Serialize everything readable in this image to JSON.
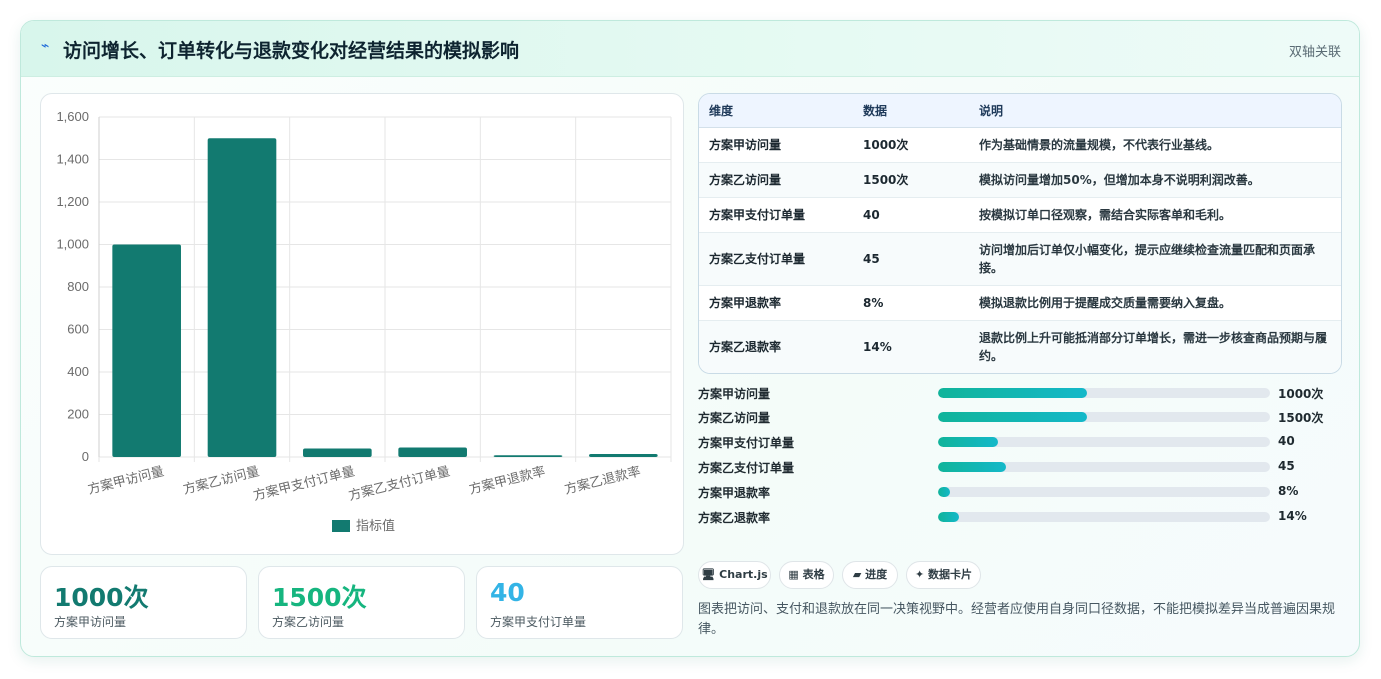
{
  "header": {
    "icon": "lightning-icon",
    "title": "访问增长、订单转化与退款变化对经营结果的模拟影响",
    "tag": "双轴关联"
  },
  "chart_data": {
    "type": "bar",
    "categories": [
      "方案甲访问量",
      "方案乙访问量",
      "方案甲支付订单量",
      "方案乙支付订单量",
      "方案甲退款率",
      "方案乙退款率"
    ],
    "series": [
      {
        "name": "指标值",
        "values": [
          1000,
          1500,
          40,
          45,
          8,
          14
        ],
        "color": "#127a70"
      }
    ],
    "ylim": [
      0,
      1600
    ],
    "yticks": [
      "0",
      "200",
      "400",
      "600",
      "800",
      "1,000",
      "1,200",
      "1,400",
      "1,600"
    ],
    "grid": true,
    "legend": "bottom"
  },
  "stats": [
    {
      "value": "1000次",
      "label": "方案甲访问量",
      "color": "#127a70"
    },
    {
      "value": "1500次",
      "label": "方案乙访问量",
      "color": "#16b57f"
    },
    {
      "value": "40",
      "label": "方案甲支付订单量",
      "color": "#33b4e6"
    }
  ],
  "table": {
    "headers": [
      "维度",
      "数据",
      "说明"
    ],
    "rows": [
      {
        "dim": "方案甲访问量",
        "data": "1000次",
        "desc": "作为基础情景的流量规模，不代表行业基线。"
      },
      {
        "dim": "方案乙访问量",
        "data": "1500次",
        "desc": "模拟访问量增加50%，但增加本身不说明利润改善。"
      },
      {
        "dim": "方案甲支付订单量",
        "data": "40",
        "desc": "按模拟订单口径观察，需结合实际客单和毛利。"
      },
      {
        "dim": "方案乙支付订单量",
        "data": "45",
        "desc": "访问增加后订单仅小幅变化，提示应继续检查流量匹配和页面承接。"
      },
      {
        "dim": "方案甲退款率",
        "data": "8%",
        "desc": "模拟退款比例用于提醒成交质量需要纳入复盘。"
      },
      {
        "dim": "方案乙退款率",
        "data": "14%",
        "desc": "退款比例上升可能抵消部分订单增长，需进一步核查商品预期与履约。"
      }
    ]
  },
  "progress": [
    {
      "label": "方案甲访问量",
      "value": "1000次",
      "fill_percent": 45
    },
    {
      "label": "方案乙访问量",
      "value": "1500次",
      "fill_percent": 45
    },
    {
      "label": "方案甲支付订单量",
      "value": "40",
      "fill_percent": 18
    },
    {
      "label": "方案乙支付订单量",
      "value": "45",
      "fill_percent": 20.5
    },
    {
      "label": "方案甲退款率",
      "value": "8%",
      "fill_percent": 3.6
    },
    {
      "label": "方案乙退款率",
      "value": "14%",
      "fill_percent": 6.3
    }
  ],
  "chips": [
    {
      "icon": "monitor-icon",
      "glyph": "🖥",
      "label": "Chart.js"
    },
    {
      "icon": "table-icon",
      "glyph": "▦",
      "label": "表格"
    },
    {
      "icon": "progress-icon",
      "glyph": "▰",
      "label": "进度"
    },
    {
      "icon": "sparkle-icon",
      "glyph": "✦",
      "label": "数据卡片"
    }
  ],
  "note": "图表把访问、支付和退款放在同一决策视野中。经营者应使用自身同口径数据，不能把模拟差异当成普遍因果规律。"
}
